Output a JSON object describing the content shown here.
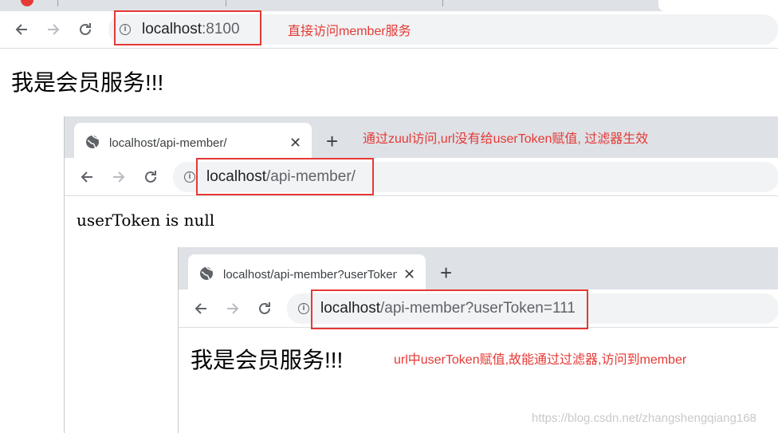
{
  "top_browser": {
    "url_host": "localhost",
    "url_rest": ":8100",
    "annotation": "直接访问member服务",
    "page_heading": "我是会员服务!!!"
  },
  "middle_browser": {
    "tab_title": "localhost/api-member/",
    "tab_close": "✕",
    "new_tab": "+",
    "url_host": "localhost",
    "url_rest": "/api-member/",
    "annotation": "通过zuul访问,url没有给userToken赋值, 过滤器生效",
    "page_body": "userToken is null"
  },
  "bottom_browser": {
    "tab_title": "localhost/api-member?userToken",
    "tab_close": "✕",
    "new_tab": "+",
    "url_host": "localhost",
    "url_rest": "/api-member?userToken=111",
    "page_heading": "我是会员服务!!!",
    "annotation": "url中userToken赋值,故能通过过滤器,访问到member"
  },
  "watermark": "https://blog.csdn.net/zhangshengqiang168",
  "icons": {
    "back": "arrow-left-icon",
    "forward": "arrow-right-icon",
    "reload": "reload-icon",
    "info": "info-icon",
    "globe": "globe-icon"
  }
}
